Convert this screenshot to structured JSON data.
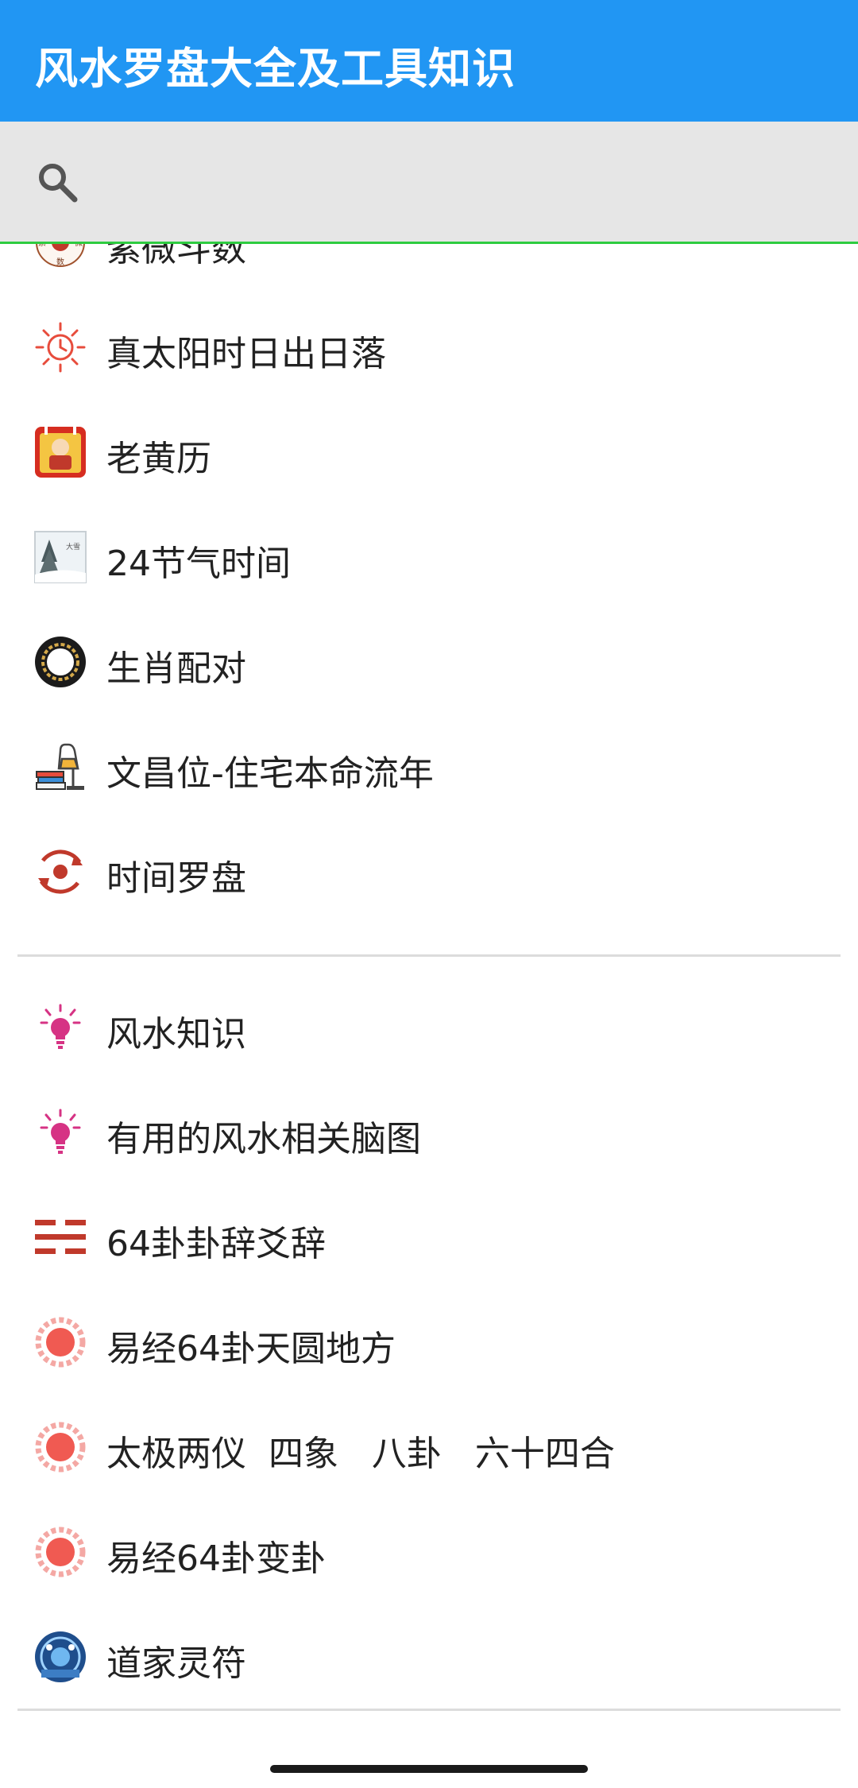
{
  "app": {
    "title": "风水罗盘大全及工具知识"
  },
  "search": {
    "icon": "search-icon"
  },
  "colors": {
    "appbar": "#2196F3",
    "searchbar": "#e6e6e6",
    "divider_accent": "#2ecc40"
  },
  "menu": {
    "group1": [
      {
        "label": "紫微斗数",
        "icon": "ziwei-seal-icon"
      },
      {
        "label": "真太阳时日出日落",
        "icon": "sun-clock-icon"
      },
      {
        "label": "老黄历",
        "icon": "almanac-icon"
      },
      {
        "label": "24节气时间",
        "icon": "solar-term-icon"
      },
      {
        "label": "生肖配对",
        "icon": "zodiac-ring-icon"
      },
      {
        "label": "文昌位-住宅本命流年",
        "icon": "study-lamp-icon"
      },
      {
        "label": "时间罗盘",
        "icon": "time-compass-icon"
      }
    ],
    "group2": [
      {
        "label": "风水知识",
        "icon": "lightbulb-icon"
      },
      {
        "label": "有用的风水相关脑图",
        "icon": "lightbulb-icon"
      },
      {
        "label": "64卦卦辞爻辞",
        "icon": "hexagram-icon"
      },
      {
        "label": "易经64卦天圆地方",
        "icon": "bagua-disc-icon"
      },
      {
        "label": "太极两仪  四象   八卦   六十四合",
        "icon": "bagua-disc-icon"
      },
      {
        "label": "易经64卦变卦",
        "icon": "bagua-disc-icon"
      },
      {
        "label": "道家灵符",
        "icon": "talisman-icon"
      }
    ]
  }
}
